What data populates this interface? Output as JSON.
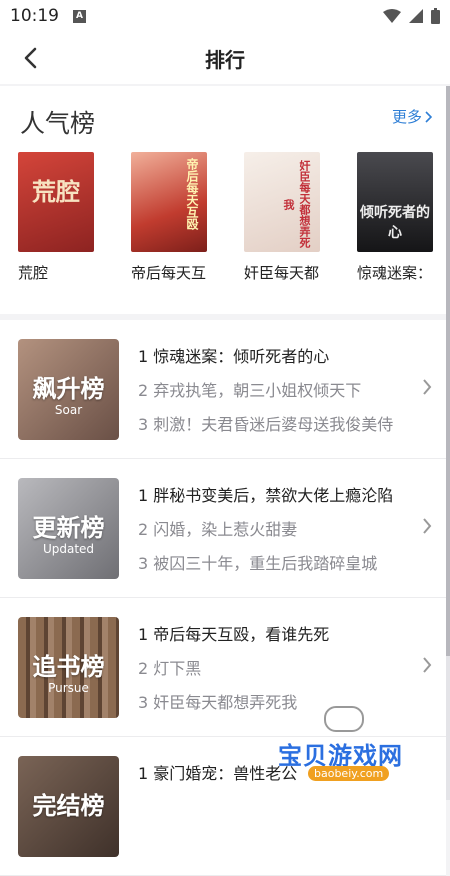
{
  "status": {
    "time": "10:19",
    "a_badge": "A"
  },
  "header": {
    "title": "排行"
  },
  "popular": {
    "title": "人气榜",
    "more_label": "更多",
    "books": [
      {
        "title": "荒腔",
        "cover_text": "荒腔",
        "cover_color": "#b8322c"
      },
      {
        "title": "帝后每天互",
        "cover_text": "帝后每天互殴",
        "cover_color": "#d9493a"
      },
      {
        "title": "奸臣每天都",
        "cover_text": "奸臣每天都想弄死我",
        "cover_color": "#e9dcd6"
      },
      {
        "title": "惊魂迷案：",
        "cover_text": "倾听死者的心",
        "cover_color": "#2b2b2e"
      }
    ]
  },
  "ranks": [
    {
      "name": "飙升榜",
      "en": "Soar",
      "thumb_color": "#8a6e60",
      "items": [
        "1 惊魂迷案：倾听死者的心",
        "2 弃戎执笔，朝三小姐权倾天下",
        "3 刺激！夫君昏迷后婆母送我俊美侍"
      ]
    },
    {
      "name": "更新榜",
      "en": "Updated",
      "thumb_color": "#8f8f93",
      "items": [
        "1 胖秘书变美后，禁欲大佬上瘾沦陷",
        "2 闪婚，染上惹火甜妻",
        "3 被囚三十年，重生后我踏碎皇城"
      ]
    },
    {
      "name": "追书榜",
      "en": "Pursue",
      "thumb_color": "#7a5b45",
      "items": [
        "1 帝后每天互殴，看谁先死",
        "2 灯下黑",
        "3 奸臣每天都想弄死我"
      ]
    },
    {
      "name": "完结榜",
      "en": "",
      "thumb_color": "#5b4a40",
      "items": [
        "1 豪门婚宠：兽性老公"
      ]
    }
  ],
  "watermark": {
    "text": "宝贝游戏网",
    "url": "baobeiy.com"
  }
}
